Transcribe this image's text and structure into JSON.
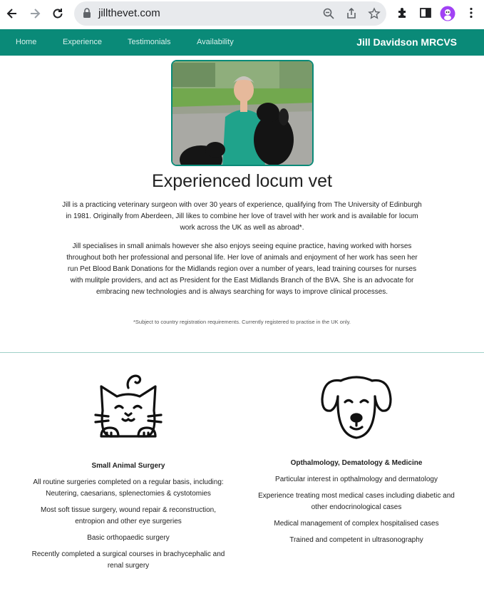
{
  "browser": {
    "url": "jillthevet.com"
  },
  "nav": {
    "items": [
      {
        "label": "Home"
      },
      {
        "label": "Experience"
      },
      {
        "label": "Testimonials"
      },
      {
        "label": "Availability"
      }
    ],
    "brand": "Jill Davidson MRCVS"
  },
  "hero": {
    "heading": "Experienced locum vet",
    "paragraph1": "Jill is a practicing veterinary surgeon with over 30 years of experience, qualifying from The University of Edinburgh in 1981. Originally from Aberdeen, Jill likes to combine her love of travel with her work and is available for locum work across the UK as well as abroad*.",
    "paragraph2": "Jill specialises in small animals however she also enjoys seeing equine practice, having worked with horses throughout both her professional and personal life. Her love of animals and enjoyment of her work has seen her run Pet Blood Bank Donations for the Midlands region over a number of years, lead training courses for nurses with mulitple providers, and act as President for the East Midlands Branch of the BVA. She is an advocate for embracing new technologies and is always searching for ways to improve clinical processes.",
    "footnote": "*Subject to country registration requirements. Currently registered to practise in the UK only."
  },
  "services": [
    {
      "title": "Small Animal Surgery",
      "icon": "cat-icon",
      "items": [
        "All routine surgeries completed on a regular basis, including: Neutering, caesarians, splenectomies & cystotomies",
        "Most soft tissue surgery, wound repair & reconstruction, entropion and other eye surgeries",
        "Basic orthopaedic surgery",
        "Recently completed a surgical courses in brachycephalic and renal surgery"
      ]
    },
    {
      "title": "Opthalmology, Dematology & Medicine",
      "icon": "dog-icon",
      "items": [
        "Particular interest in opthalmology and dermatology",
        "Experience treating most medical cases including diabetic and other endocrinological cases",
        "Medical management of complex hospitalised cases",
        "Trained and competent in ultrasonography"
      ]
    }
  ],
  "colors": {
    "brand": "#0a8a78",
    "rule": "#9fd0c8"
  }
}
